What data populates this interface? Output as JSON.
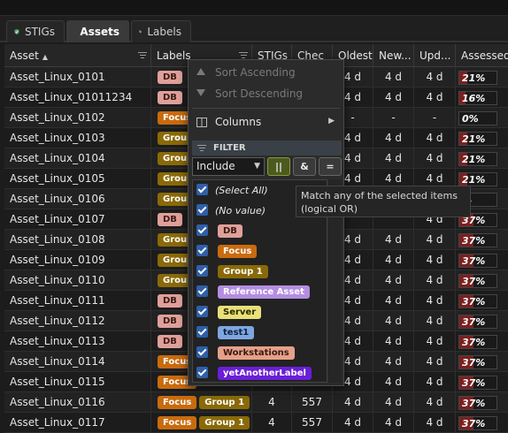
{
  "tabs": [
    {
      "label": "STIGs",
      "icon": "shield-check-icon"
    },
    {
      "label": "Assets",
      "icon": "target-icon"
    },
    {
      "label": "Labels",
      "icon": "tag-icon"
    }
  ],
  "columns": [
    "Asset",
    "Labels",
    "STIGs",
    "Chec",
    "Oldest",
    "New...",
    "Upd...",
    "Assessed"
  ],
  "label_colors": {
    "DB": {
      "bg": "#e0a09a",
      "fg": "#3a1a16"
    },
    "Focus": {
      "bg": "#c96b0e",
      "fg": "#ffffff"
    },
    "Group 1": {
      "bg": "#8a6a08",
      "fg": "#ffffff"
    },
    "Reference Asset": {
      "bg": "#b48ee0",
      "fg": "#ffffff"
    },
    "Server": {
      "bg": "#e9e07a",
      "fg": "#2a2a00"
    },
    "test1": {
      "bg": "#7ea6e0",
      "fg": "#102040"
    },
    "Workstations": {
      "bg": "#e6a08a",
      "fg": "#3a1a10"
    },
    "yetAnotherLabel": {
      "bg": "#6a1fd6",
      "fg": "#ffffff"
    }
  },
  "rows": [
    {
      "asset": "Asset_Linux_0101",
      "labels": [
        "DB"
      ],
      "stigs": "",
      "checks": "",
      "oldest": "4 d",
      "newest": "4 d",
      "updated": "4 d",
      "assessed": "21%",
      "pct": 0.21
    },
    {
      "asset": "Asset_Linux_01011234",
      "labels": [
        "DB"
      ],
      "stigs": "",
      "checks": "",
      "oldest": "4 d",
      "newest": "4 d",
      "updated": "4 d",
      "assessed": "16%",
      "pct": 0.16
    },
    {
      "asset": "Asset_Linux_0102",
      "labels": [
        "Focus"
      ],
      "stigs": "",
      "checks": "",
      "oldest": "-",
      "newest": "-",
      "updated": "-",
      "assessed": "0%",
      "pct": 0
    },
    {
      "asset": "Asset_Linux_0103",
      "labels": [
        "Group"
      ],
      "stigs": "",
      "checks": "",
      "oldest": "4 d",
      "newest": "4 d",
      "updated": "4 d",
      "assessed": "21%",
      "pct": 0.21
    },
    {
      "asset": "Asset_Linux_0104",
      "labels": [
        "Group"
      ],
      "stigs": "",
      "checks": "",
      "oldest": "4 d",
      "newest": "4 d",
      "updated": "4 d",
      "assessed": "21%",
      "pct": 0.21
    },
    {
      "asset": "Asset_Linux_0105",
      "labels": [
        "Group"
      ],
      "stigs": "",
      "checks": "",
      "oldest": "4 d",
      "newest": "4 d",
      "updated": "4 d",
      "assessed": "21%",
      "pct": 0.21
    },
    {
      "asset": "Asset_Linux_0106",
      "labels": [
        "Group"
      ],
      "stigs": "",
      "checks": "",
      "oldest": "",
      "newest": "",
      "updated": "",
      "assessed": "%",
      "pct": 0.1
    },
    {
      "asset": "Asset_Linux_0107",
      "labels": [
        "DB"
      ],
      "stigs": "",
      "checks": "",
      "oldest": "",
      "newest": "",
      "updated": "4 d",
      "assessed": "37%",
      "pct": 0.37
    },
    {
      "asset": "Asset_Linux_0108",
      "labels": [
        "Group"
      ],
      "stigs": "",
      "checks": "",
      "oldest": "4 d",
      "newest": "4 d",
      "updated": "4 d",
      "assessed": "37%",
      "pct": 0.37
    },
    {
      "asset": "Asset_Linux_0109",
      "labels": [
        "Group"
      ],
      "stigs": "",
      "checks": "",
      "oldest": "4 d",
      "newest": "4 d",
      "updated": "4 d",
      "assessed": "37%",
      "pct": 0.37
    },
    {
      "asset": "Asset_Linux_0110",
      "labels": [
        "Group"
      ],
      "stigs": "",
      "checks": "",
      "oldest": "4 d",
      "newest": "4 d",
      "updated": "4 d",
      "assessed": "37%",
      "pct": 0.37
    },
    {
      "asset": "Asset_Linux_0111",
      "labels": [
        "DB"
      ],
      "stigs": "",
      "checks": "",
      "oldest": "4 d",
      "newest": "4 d",
      "updated": "4 d",
      "assessed": "37%",
      "pct": 0.37
    },
    {
      "asset": "Asset_Linux_0112",
      "labels": [
        "DB"
      ],
      "stigs": "",
      "checks": "",
      "oldest": "4 d",
      "newest": "4 d",
      "updated": "4 d",
      "assessed": "37%",
      "pct": 0.37
    },
    {
      "asset": "Asset_Linux_0113",
      "labels": [
        "DB"
      ],
      "stigs": "",
      "checks": "",
      "oldest": "4 d",
      "newest": "4 d",
      "updated": "4 d",
      "assessed": "37%",
      "pct": 0.37
    },
    {
      "asset": "Asset_Linux_0114",
      "labels": [
        "Focus"
      ],
      "stigs": "",
      "checks": "",
      "oldest": "4 d",
      "newest": "4 d",
      "updated": "4 d",
      "assessed": "37%",
      "pct": 0.37
    },
    {
      "asset": "Asset_Linux_0115",
      "labels": [
        "Focus"
      ],
      "stigs": "",
      "checks": "",
      "oldest": "4 d",
      "newest": "4 d",
      "updated": "4 d",
      "assessed": "37%",
      "pct": 0.37
    },
    {
      "asset": "Asset_Linux_0116",
      "labels": [
        "Focus",
        "Group 1"
      ],
      "stigs": "4",
      "checks": "557",
      "oldest": "4 d",
      "newest": "4 d",
      "updated": "4 d",
      "assessed": "37%",
      "pct": 0.37
    },
    {
      "asset": "Asset_Linux_0117",
      "labels": [
        "Focus",
        "Group 1"
      ],
      "stigs": "4",
      "checks": "557",
      "oldest": "4 d",
      "newest": "4 d",
      "updated": "4 d",
      "assessed": "37%",
      "pct": 0.37
    }
  ],
  "column_menu": {
    "sort_ascending": "Sort Ascending",
    "sort_descending": "Sort Descending",
    "columns": "Columns",
    "filter_header": "FILTER",
    "mode": "Include",
    "ops": [
      "||",
      "&",
      "="
    ],
    "items": [
      {
        "text": "(Select All)",
        "checked": true
      },
      {
        "text": "(No value)",
        "checked": true
      },
      {
        "label": "DB",
        "checked": true
      },
      {
        "label": "Focus",
        "checked": true
      },
      {
        "label": "Group 1",
        "checked": true
      },
      {
        "label": "Reference Asset",
        "checked": true
      },
      {
        "label": "Server",
        "checked": true
      },
      {
        "label": "test1",
        "checked": true
      },
      {
        "label": "Workstations",
        "checked": true
      },
      {
        "label": "yetAnotherLabel",
        "checked": true
      }
    ]
  },
  "tooltip": {
    "line1": "Match any of the selected items",
    "line2": "(logical OR)"
  }
}
